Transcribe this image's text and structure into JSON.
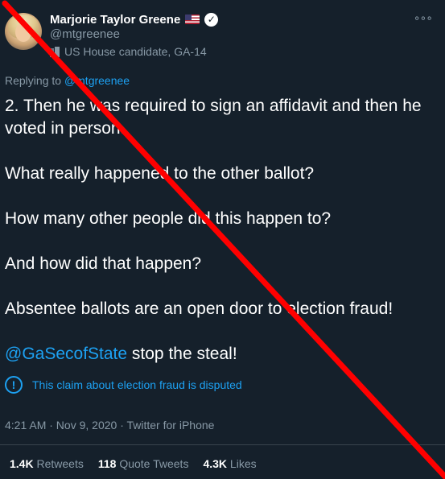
{
  "author": {
    "name": "Marjorie Taylor Greene",
    "handle": "@mtgreenee",
    "label": "US House candidate, GA-14"
  },
  "reply": {
    "prefix": "Replying to ",
    "handle": "@mtgreenee"
  },
  "tweet": {
    "line1": "2.  Then he was required to sign an affidavit and then he voted in person.",
    "line2": "What really happened to the other ballot?",
    "line3": "How many other people did this happen to?",
    "line4": "And how did that happen?",
    "line5": "Absentee ballots are an open door to election fraud!",
    "mention": "@GaSecofState",
    "line6_rest": " stop the steal!"
  },
  "notice": {
    "text": "This claim about election fraud is disputed"
  },
  "meta": {
    "text": "4:21 AM · Nov 9, 2020 · Twitter for iPhone"
  },
  "stats": {
    "retweets_count": "1.4K",
    "retweets_label": "Retweets",
    "quotes_count": "118",
    "quotes_label": "Quote Tweets",
    "likes_count": "4.3K",
    "likes_label": "Likes"
  },
  "icons": {
    "verified": "verified-badge-icon",
    "flag": "us-flag-icon",
    "label": "government-building-icon",
    "more": "more-options-icon",
    "info": "info-icon"
  },
  "colors": {
    "background": "#15202b",
    "accent": "#1da1f2",
    "secondary_text": "#8899a6",
    "overlay_slash": "#ff0000"
  }
}
